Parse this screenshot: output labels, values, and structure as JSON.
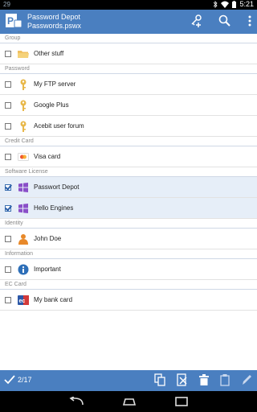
{
  "status": {
    "left": "29",
    "time": "5:21"
  },
  "header": {
    "title_line1": "Password Depot",
    "title_line2": "Passwords.pswx"
  },
  "sections": [
    {
      "label": "Group",
      "items": [
        {
          "label": "Other stuff",
          "icon": "folder-icon",
          "checked": false
        }
      ]
    },
    {
      "label": "Password",
      "items": [
        {
          "label": "My FTP server",
          "icon": "key-icon",
          "checked": false
        },
        {
          "label": "Google Plus",
          "icon": "key-icon",
          "checked": false
        },
        {
          "label": "Acebit user forum",
          "icon": "key-icon",
          "checked": false
        }
      ]
    },
    {
      "label": "Credit Card",
      "items": [
        {
          "label": "Visa card",
          "icon": "credit-card-icon",
          "checked": false
        }
      ]
    },
    {
      "label": "Software License",
      "items": [
        {
          "label": "Passwort Depot",
          "icon": "windows-icon",
          "checked": true
        },
        {
          "label": "Hello Engines",
          "icon": "windows-icon",
          "checked": true
        }
      ]
    },
    {
      "label": "Identity",
      "items": [
        {
          "label": "John Doe",
          "icon": "person-icon",
          "checked": false
        }
      ]
    },
    {
      "label": "Information",
      "items": [
        {
          "label": "Important",
          "icon": "info-icon",
          "checked": false
        }
      ]
    },
    {
      "label": "EC Card",
      "items": [
        {
          "label": "My bank card",
          "icon": "ec-card-icon",
          "checked": false
        }
      ]
    }
  ],
  "toolbar": {
    "count": "2/17"
  },
  "colors": {
    "accent": "#4a7fc0",
    "selected_row": "#e6eef8",
    "key": "#e8b84a",
    "windows": "#8a4fc8",
    "info": "#2e6fb8",
    "person": "#e8892a"
  }
}
